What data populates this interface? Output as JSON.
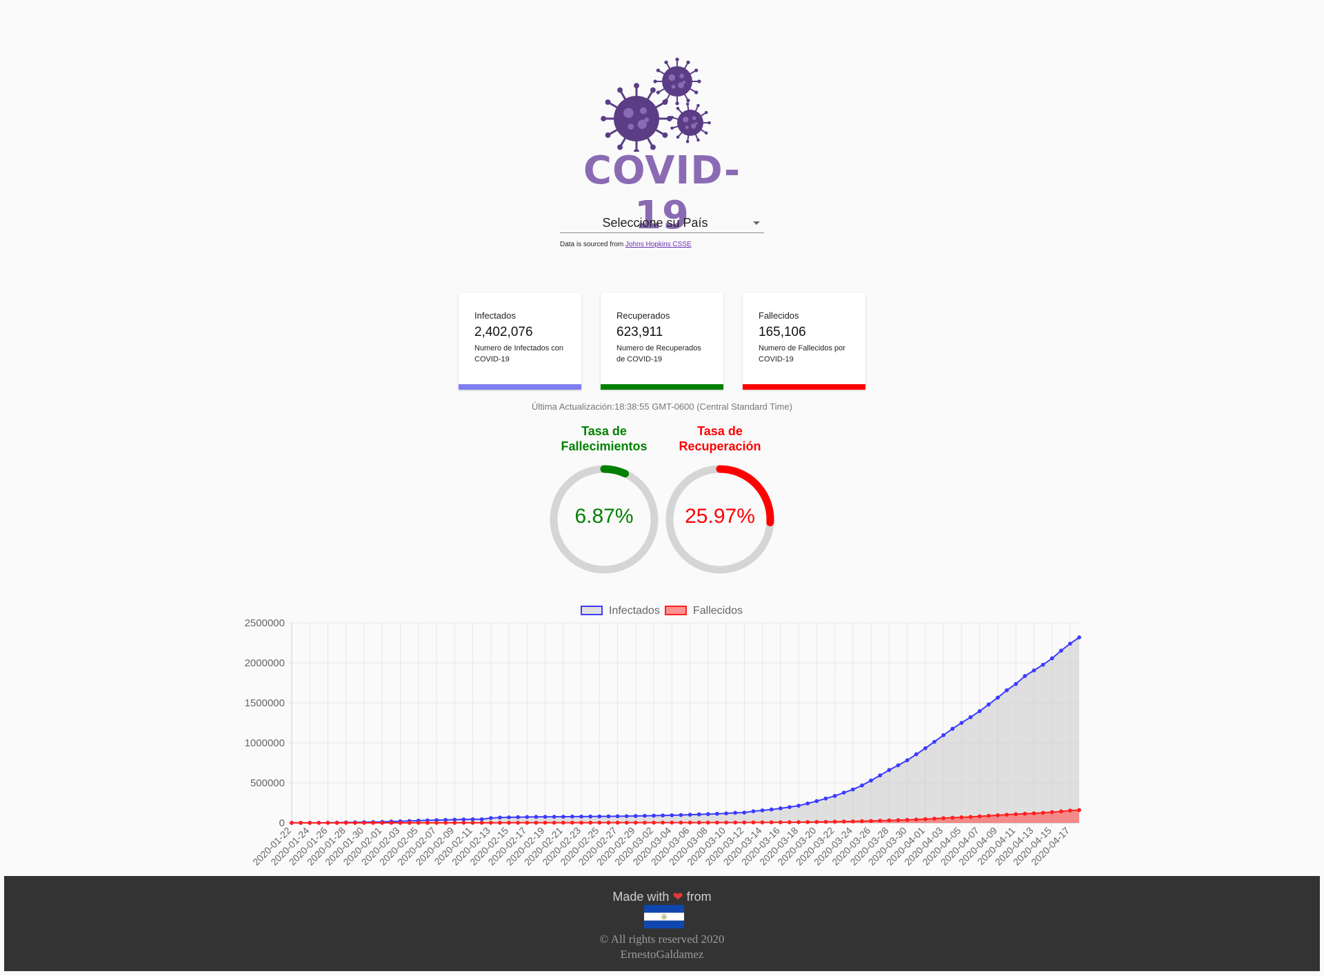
{
  "header": {
    "logo_text": "COVID-19",
    "select_label": "Seleccione su País",
    "source_prefix": "Data is sourced from",
    "source_link": "Johns Hopkins CSSE"
  },
  "cards": [
    {
      "title": "Infectados",
      "value": "2,402,076",
      "desc": "Numero de Infectados con COVID-19",
      "color": "#7f7ff0"
    },
    {
      "title": "Recuperados",
      "value": "623,911",
      "desc": "Numero de Recuperados de COVID-19",
      "color": "#008000"
    },
    {
      "title": "Fallecidos",
      "value": "165,106",
      "desc": "Numero de Fallecidos por COVID-19",
      "color": "#ff0000"
    }
  ],
  "updated": "Última Actualización:18:38:55 GMT-0600 (Central Standard Time)",
  "gauges": [
    {
      "title_line1": "Tasa de",
      "title_line2": "Fallecimientos",
      "value_text": "6.87%",
      "fraction": 0.0687,
      "color": "#008000"
    },
    {
      "title_line1": "Tasa de",
      "title_line2": "Recuperación",
      "value_text": "25.97%",
      "fraction": 0.2597,
      "color": "#ff0000"
    }
  ],
  "chart_data": {
    "type": "line",
    "grid": true,
    "legend": "top-center",
    "ylim": [
      0,
      2500000
    ],
    "yticks": [
      "0",
      "500000",
      "1000000",
      "1500000",
      "2000000",
      "2500000"
    ],
    "x_start": "2020-01-22",
    "x_end": "2020-04-18",
    "x_label_every": 2,
    "series": [
      {
        "name": "Infectados",
        "color": "#3b3bff",
        "fill": "rgba(200,200,200,0.55)",
        "values": [
          555,
          654,
          941,
          1434,
          2118,
          2927,
          5578,
          6166,
          8234,
          9927,
          12038,
          16787,
          19881,
          23892,
          27635,
          30794,
          34391,
          37120,
          40150,
          42762,
          44802,
          45221,
          60368,
          66885,
          69030,
          71224,
          73258,
          75136,
          75639,
          76197,
          76819,
          78572,
          78958,
          79561,
          80406,
          81388,
          82746,
          84112,
          86011,
          88369,
          90306,
          92840,
          95120,
          98282,
          102200,
          106100,
          109800,
          113600,
          118600,
          125900,
          128400,
          145200,
          156100,
          167400,
          181500,
          197100,
          214900,
          242700,
          272100,
          304500,
          337000,
          378200,
          418000,
          467600,
          529600,
          593300,
          660700,
          720100,
          782400,
          857500,
          932600,
          1013000,
          1095900,
          1176000,
          1249700,
          1321400,
          1396500,
          1480200,
          1565300,
          1657500,
          1735700,
          1835100,
          1905100,
          1976200,
          2056100,
          2152400,
          2240200,
          2317800
        ]
      },
      {
        "name": "Fallecidos",
        "color": "#ff2020",
        "fill": "rgba(255,90,90,0.65)",
        "values": [
          17,
          18,
          26,
          42,
          56,
          82,
          131,
          133,
          171,
          213,
          259,
          362,
          426,
          492,
          564,
          634,
          719,
          806,
          906,
          1013,
          1113,
          1118,
          1371,
          1523,
          1666,
          1770,
          1868,
          2007,
          2122,
          2247,
          2251,
          2458,
          2469,
          2629,
          2708,
          2770,
          2814,
          2872,
          2941,
          2996,
          3085,
          3160,
          3254,
          3348,
          3460,
          3558,
          3802,
          3988,
          4262,
          4615,
          4720,
          5404,
          5819,
          6440,
          7126,
          7905,
          8733,
          9867,
          11299,
          12973,
          14651,
          16505,
          18625,
          21181,
          23970,
          27198,
          30652,
          33925,
          37582,
          42107,
          46809,
          52983,
          58787,
          64606,
          69374,
          74565,
          81865,
          88338,
          95455,
          102525,
          108503,
          114091,
          119482,
          125984,
          134177,
          143800,
          153822,
          160000
        ]
      }
    ]
  },
  "footer": {
    "made_with": "Made with",
    "heart": "❤",
    "from": "from",
    "rights_line1": "© All rights reserved 2020",
    "rights_line2": "ErnestoGaldamez"
  }
}
